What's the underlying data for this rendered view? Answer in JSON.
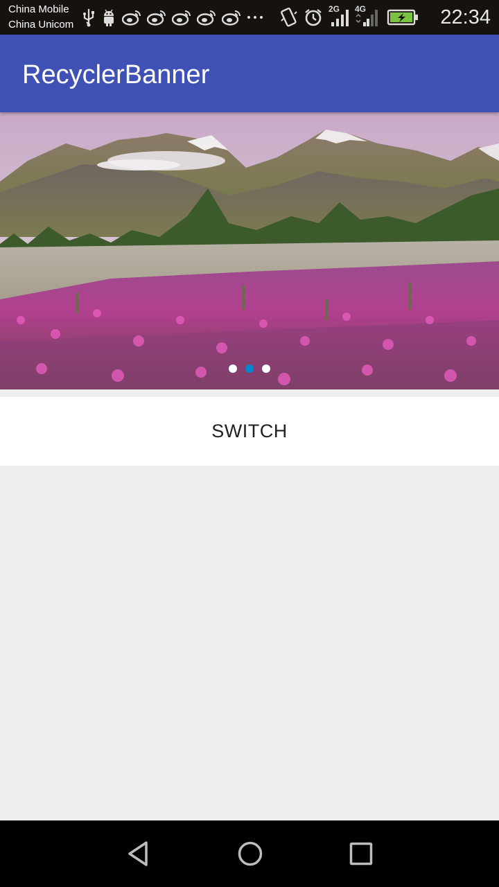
{
  "status_bar": {
    "carrier_1": "China Mobile",
    "carrier_2": "China Unicom",
    "icons": [
      "usb-icon",
      "android-icon",
      "weibo-icon",
      "weibo-icon",
      "weibo-icon",
      "weibo-icon",
      "weibo-icon",
      "more-dots-icon",
      "vibrate-icon",
      "alarm-icon",
      "signal-2g-icon",
      "signal-4g-icon",
      "battery-charging-icon"
    ],
    "network_1": "2G",
    "network_2": "4G",
    "time": "22:34"
  },
  "app_bar": {
    "title": "RecyclerBanner",
    "color": "#3f51b5"
  },
  "banner": {
    "image": "mountain-meadow-photo",
    "page_count": 3,
    "active_index": 1,
    "indicator_active_color": "#0288d1",
    "indicator_inactive_color": "#ffffff"
  },
  "switch_button": {
    "label": "SWITCH"
  },
  "nav_bar": {
    "icons": [
      "back-icon",
      "home-icon",
      "recents-icon"
    ]
  }
}
